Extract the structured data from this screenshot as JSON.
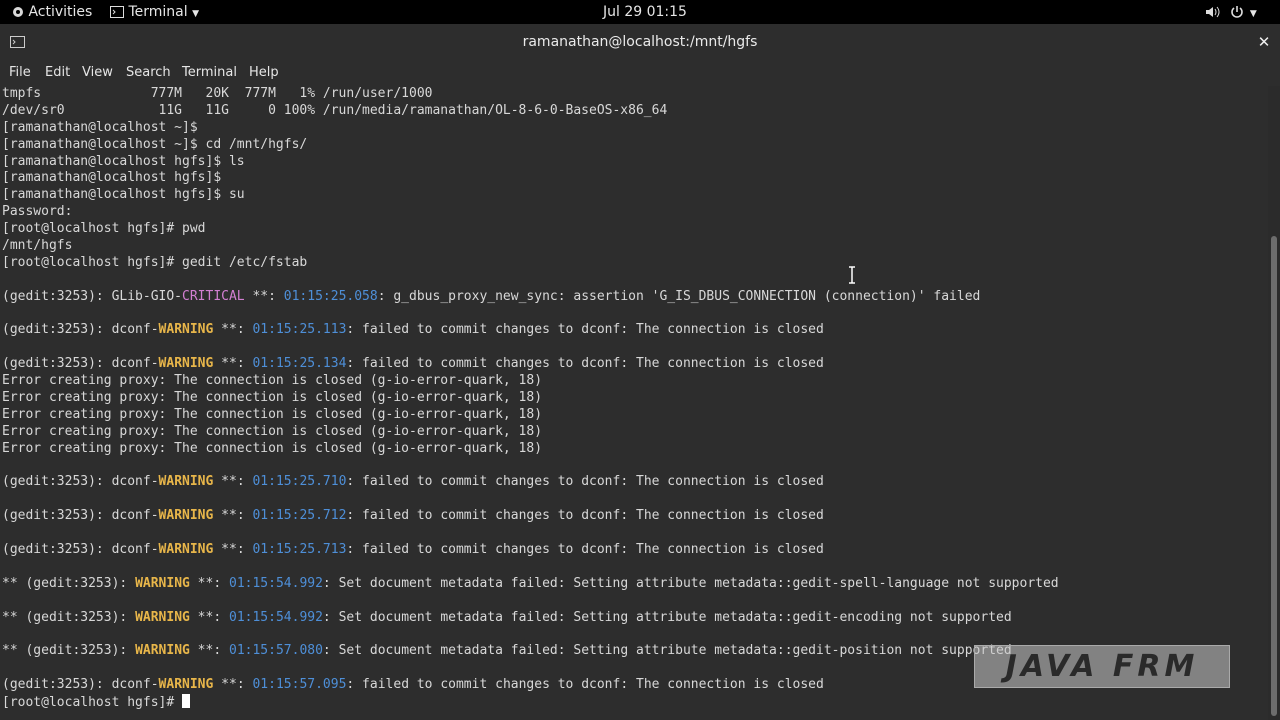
{
  "topbar": {
    "activities": "Activities",
    "app_menu": "Terminal",
    "clock": "Jul 29  01:15"
  },
  "window": {
    "title": "ramanathan@localhost:/mnt/hgfs"
  },
  "menubar": [
    "File",
    "Edit",
    "View",
    "Search",
    "Terminal",
    "Help"
  ],
  "watermark": "JAVA FRM",
  "terminal_lines": [
    [
      {
        "t": "tmpfs              777M   20K  777M   1% /run/user/1000"
      }
    ],
    [
      {
        "t": "/dev/sr0            11G   11G     0 100% /run/media/ramanathan/OL-8-6-0-BaseOS-x86_64"
      }
    ],
    [
      {
        "t": "[ramanathan@localhost ~]$"
      }
    ],
    [
      {
        "t": "[ramanathan@localhost ~]$ cd /mnt/hgfs/"
      }
    ],
    [
      {
        "t": "[ramanathan@localhost hgfs]$ ls"
      }
    ],
    [
      {
        "t": "[ramanathan@localhost hgfs]$"
      }
    ],
    [
      {
        "t": "[ramanathan@localhost hgfs]$ su"
      }
    ],
    [
      {
        "t": "Password:"
      }
    ],
    [
      {
        "t": "[root@localhost hgfs]# pwd"
      }
    ],
    [
      {
        "t": "/mnt/hgfs"
      }
    ],
    [
      {
        "t": "[root@localhost hgfs]# gedit /etc/fstab"
      }
    ],
    [
      {
        "t": ""
      }
    ],
    [
      {
        "t": "(gedit:3253): GLib-GIO-"
      },
      {
        "t": "CRITICAL",
        "c": "crit"
      },
      {
        "t": " **: "
      },
      {
        "t": "01:15:25.058",
        "c": "ts"
      },
      {
        "t": ": g_dbus_proxy_new_sync: assertion 'G_IS_DBUS_CONNECTION (connection)' failed"
      }
    ],
    [
      {
        "t": ""
      }
    ],
    [
      {
        "t": "(gedit:3253): dconf-"
      },
      {
        "t": "WARNING",
        "c": "warn"
      },
      {
        "t": " **: "
      },
      {
        "t": "01:15:25.113",
        "c": "ts"
      },
      {
        "t": ": failed to commit changes to dconf: The connection is closed"
      }
    ],
    [
      {
        "t": ""
      }
    ],
    [
      {
        "t": "(gedit:3253): dconf-"
      },
      {
        "t": "WARNING",
        "c": "warn"
      },
      {
        "t": " **: "
      },
      {
        "t": "01:15:25.134",
        "c": "ts"
      },
      {
        "t": ": failed to commit changes to dconf: The connection is closed"
      }
    ],
    [
      {
        "t": "Error creating proxy: The connection is closed (g-io-error-quark, 18)"
      }
    ],
    [
      {
        "t": "Error creating proxy: The connection is closed (g-io-error-quark, 18)"
      }
    ],
    [
      {
        "t": "Error creating proxy: The connection is closed (g-io-error-quark, 18)"
      }
    ],
    [
      {
        "t": "Error creating proxy: The connection is closed (g-io-error-quark, 18)"
      }
    ],
    [
      {
        "t": "Error creating proxy: The connection is closed (g-io-error-quark, 18)"
      }
    ],
    [
      {
        "t": ""
      }
    ],
    [
      {
        "t": "(gedit:3253): dconf-"
      },
      {
        "t": "WARNING",
        "c": "warn"
      },
      {
        "t": " **: "
      },
      {
        "t": "01:15:25.710",
        "c": "ts"
      },
      {
        "t": ": failed to commit changes to dconf: The connection is closed"
      }
    ],
    [
      {
        "t": ""
      }
    ],
    [
      {
        "t": "(gedit:3253): dconf-"
      },
      {
        "t": "WARNING",
        "c": "warn"
      },
      {
        "t": " **: "
      },
      {
        "t": "01:15:25.712",
        "c": "ts"
      },
      {
        "t": ": failed to commit changes to dconf: The connection is closed"
      }
    ],
    [
      {
        "t": ""
      }
    ],
    [
      {
        "t": "(gedit:3253): dconf-"
      },
      {
        "t": "WARNING",
        "c": "warn"
      },
      {
        "t": " **: "
      },
      {
        "t": "01:15:25.713",
        "c": "ts"
      },
      {
        "t": ": failed to commit changes to dconf: The connection is closed"
      }
    ],
    [
      {
        "t": ""
      }
    ],
    [
      {
        "t": "** (gedit:3253): "
      },
      {
        "t": "WARNING",
        "c": "warn"
      },
      {
        "t": " **: "
      },
      {
        "t": "01:15:54.992",
        "c": "ts"
      },
      {
        "t": ": Set document metadata failed: Setting attribute metadata::gedit-spell-language not supported"
      }
    ],
    [
      {
        "t": ""
      }
    ],
    [
      {
        "t": "** (gedit:3253): "
      },
      {
        "t": "WARNING",
        "c": "warn"
      },
      {
        "t": " **: "
      },
      {
        "t": "01:15:54.992",
        "c": "ts"
      },
      {
        "t": ": Set document metadata failed: Setting attribute metadata::gedit-encoding not supported"
      }
    ],
    [
      {
        "t": ""
      }
    ],
    [
      {
        "t": "** (gedit:3253): "
      },
      {
        "t": "WARNING",
        "c": "warn"
      },
      {
        "t": " **: "
      },
      {
        "t": "01:15:57.080",
        "c": "ts"
      },
      {
        "t": ": Set document metadata failed: Setting attribute metadata::gedit-position not supported"
      }
    ],
    [
      {
        "t": ""
      }
    ],
    [
      {
        "t": "(gedit:3253): dconf-"
      },
      {
        "t": "WARNING",
        "c": "warn"
      },
      {
        "t": " **: "
      },
      {
        "t": "01:15:57.095",
        "c": "ts"
      },
      {
        "t": ": failed to commit changes to dconf: The connection is closed"
      }
    ],
    [
      {
        "t": "[root@localhost hgfs]# "
      }
    ]
  ]
}
